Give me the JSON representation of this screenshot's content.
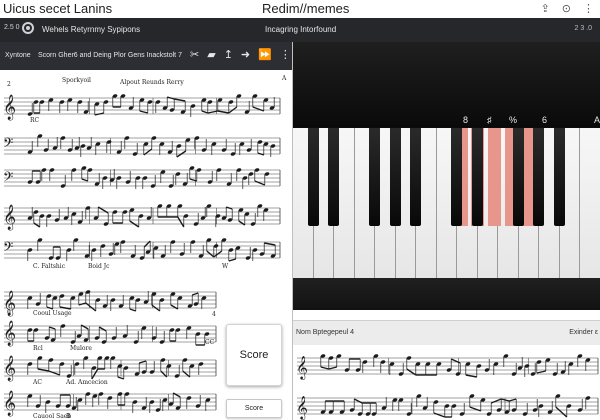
{
  "window": {
    "app_title": "Uicus secet Lanins",
    "center_title": "Redim//memes",
    "icons": [
      "share-icon",
      "help-icon",
      "menu-icon"
    ]
  },
  "toolbar": {
    "badge": "2.5 0",
    "prefs_label": "Wehels Retyrnmy Sypipons",
    "center_label": "Incagring Intorfound",
    "right_text": "2 3 .0"
  },
  "score_panel": {
    "label": "Xyntone",
    "title": "Scorn Gher6 and Deing Plor Gens Inackstolt 7",
    "tools": [
      "scissors",
      "bookmark",
      "arrow-up",
      "arrow-right",
      "fast-forward",
      "more"
    ],
    "top_letter": "A",
    "annotations": {
      "s1_num": "2",
      "s1_a": "Sporkyoil",
      "s1_b": "Alpout Reunds Rerry",
      "s2": "RC",
      "s5_a": "C. Faltshic",
      "s5_b": "Boid Jc",
      "s5_c": "W",
      "s6_num": "6",
      "s6_a": "Cooul Usage",
      "s6_b": "4",
      "s6_c": "CC",
      "s7_a": "Rcl",
      "s7_b": "Mulore",
      "s8_a": "AC",
      "s8_b": "Ad. Amcecion",
      "s9_a": "Cauool Saeb",
      "s9_b": "B"
    },
    "score_card_label": "Score",
    "score_button_label": "Score"
  },
  "keyboard": {
    "labels": [
      "8",
      "♯",
      "%",
      "6",
      "A"
    ],
    "highlight_color": "#e8958c"
  },
  "bottom_panel": {
    "label": "Nom Bptegepeul  4",
    "right": "Exinder ε"
  }
}
